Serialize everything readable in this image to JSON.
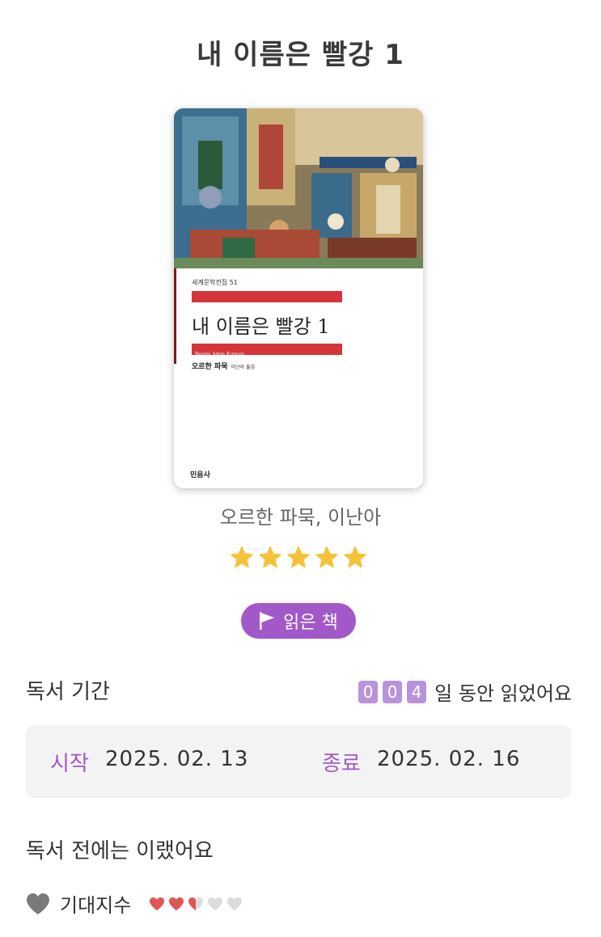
{
  "book": {
    "title": "내 이름은 빨강 1",
    "authors": "오르한 파묵, 이난아",
    "rating": 5,
    "rating_max": 5,
    "cover": {
      "series": "세계문학전집 51",
      "title": "내 이름은 빨강 1",
      "original_title": "Benim Adım Kırmızı",
      "author": "오르한 파묵",
      "translator": "이난아 옮김",
      "publisher": "민음사"
    }
  },
  "status": {
    "label": "읽은 책",
    "color": "#a158c8"
  },
  "reading_period": {
    "section_title": "독서 기간",
    "day_digits": [
      "0",
      "0",
      "4"
    ],
    "days_suffix": "일 동안 읽었어요",
    "start_label": "시작",
    "start_date": "2025. 02. 13",
    "end_label": "종료",
    "end_date": "2025. 02. 16"
  },
  "before_reading": {
    "section_title": "독서 전에는 이랬어요",
    "expectation_label": "기대지수",
    "expectation_score": 2.5,
    "expectation_max": 5
  },
  "colors": {
    "accent": "#a158c8",
    "digit_bg": "#b993da",
    "star": "#f5c33b",
    "heart": "#e05656",
    "heart_empty": "#dcdcdc"
  },
  "icons": {
    "star": "star-icon",
    "flag": "flag-icon",
    "heart": "heart-icon"
  }
}
